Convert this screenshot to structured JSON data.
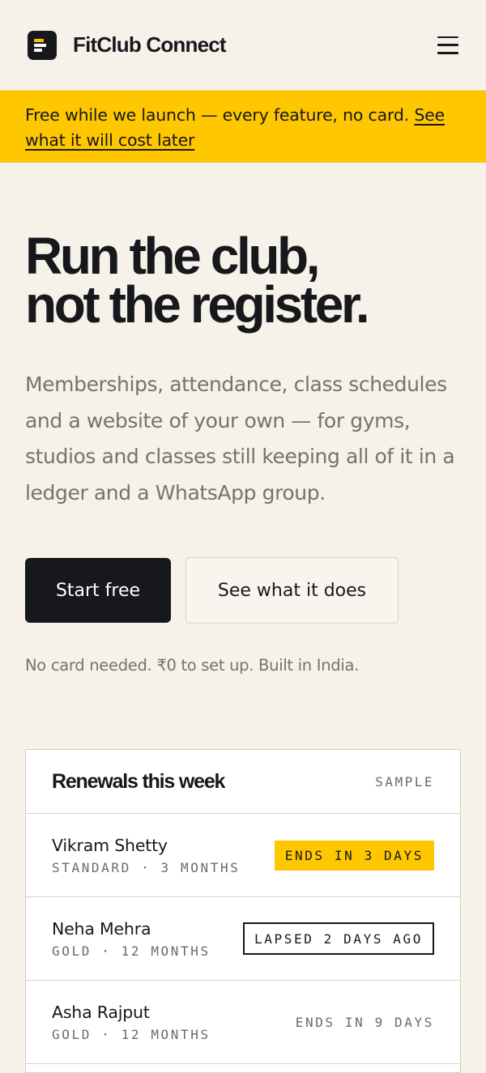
{
  "header": {
    "brand_name": "FitClub Connect",
    "logo_icon": "logo-icon",
    "menu_icon": "hamburger-menu-icon"
  },
  "banner": {
    "text": "Free while we launch — every feature, no card. ",
    "link_text": "See what it will cost later"
  },
  "hero": {
    "title_line1": "Run the club,",
    "title_line2": "not the register.",
    "subtitle": "Memberships, attendance, class schedules and a website of your own — for gyms, studios and classes still keeping all of it in a ledger and a WhatsApp group.",
    "primary_cta": "Start free",
    "secondary_cta": "See what it does",
    "fineprint": "No card needed. ₹0 to set up. Built in India."
  },
  "renewals_card": {
    "title": "Renewals this week",
    "tag": "SAMPLE",
    "rows": [
      {
        "name": "Vikram Shetty",
        "plan": "STANDARD · 3 MONTHS",
        "status": "ENDS IN 3 DAYS"
      },
      {
        "name": "Neha Mehra",
        "plan": "GOLD · 12 MONTHS",
        "status": "LAPSED 2 DAYS AGO"
      },
      {
        "name": "Asha Rajput",
        "plan": "GOLD · 12 MONTHS",
        "status": "ENDS IN 9 DAYS"
      }
    ]
  },
  "colors": {
    "accent_yellow": "#ffc700",
    "ink": "#17181c",
    "background": "#f6f2ea",
    "muted_text": "#76736b"
  }
}
